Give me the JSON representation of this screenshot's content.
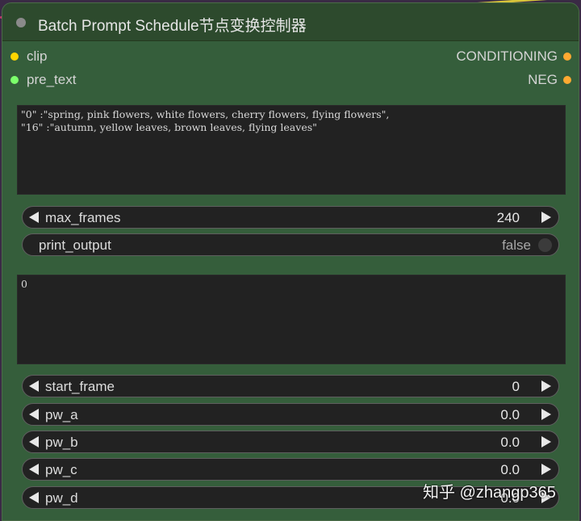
{
  "colors": {
    "node_bg": "#355e3b",
    "header_bg": "#2d4a2d",
    "clip_slot": "#ffd500",
    "pre_text_slot": "#7cff6b",
    "output_slot": "#ffa931",
    "widget_bg": "#222222"
  },
  "node": {
    "title": "Batch Prompt Schedule节点变换控制器",
    "inputs": [
      {
        "label": "clip",
        "color_key": "clip_slot"
      },
      {
        "label": "pre_text",
        "color_key": "pre_text_slot"
      }
    ],
    "outputs": [
      {
        "label": "CONDITIONING"
      },
      {
        "label": "NEG"
      }
    ],
    "prompt_text": "\"0\" :\"spring, pink flowers, white flowers, cherry flowers, flying flowers\",\n\"16\" :\"autumn, yellow leaves, brown leaves, flying leaves\"",
    "max_frames": {
      "label": "max_frames",
      "value": "240"
    },
    "print_output": {
      "label": "print_output",
      "value": "false"
    },
    "pre_text_value": "0",
    "start_frame": {
      "label": "start_frame",
      "value": "0"
    },
    "pw_a": {
      "label": "pw_a",
      "value": "0.0"
    },
    "pw_b": {
      "label": "pw_b",
      "value": "0.0"
    },
    "pw_c": {
      "label": "pw_c",
      "value": "0.0"
    },
    "pw_d": {
      "label": "pw_d",
      "value": "0.0"
    }
  },
  "watermark": "知乎 @zhangp365"
}
